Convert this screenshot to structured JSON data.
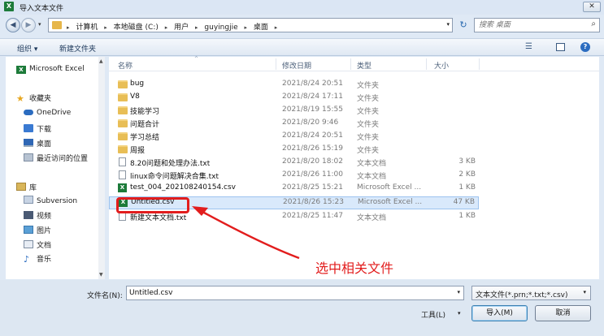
{
  "window": {
    "title": "导入文本文件",
    "app_icon_text": "X",
    "close_label": "✕"
  },
  "nav": {
    "back": "◀",
    "forward": "▶",
    "dropdown": "▾",
    "refresh": "↻"
  },
  "address": {
    "crumbs": [
      "计算机",
      "本地磁盘 (C:)",
      "用户",
      "guyingjie",
      "桌面"
    ],
    "separator": "▸",
    "dropdown": "▾"
  },
  "search": {
    "placeholder": "搜索 桌面",
    "icon": "search-icon"
  },
  "toolbar": {
    "organize": "组织 ▾",
    "new_folder": "新建文件夹",
    "view_icon": "☰",
    "help": "?"
  },
  "sidebar": {
    "items": [
      {
        "label": "Microsoft Excel",
        "icon": "X"
      },
      {
        "label": "收藏夹",
        "icon": "★"
      },
      {
        "label": "OneDrive",
        "icon": ""
      },
      {
        "label": "下载",
        "icon": ""
      },
      {
        "label": "桌面",
        "icon": ""
      },
      {
        "label": "最近访问的位置",
        "icon": ""
      },
      {
        "label": "库",
        "icon": ""
      },
      {
        "label": "Subversion",
        "icon": ""
      },
      {
        "label": "视频",
        "icon": ""
      },
      {
        "label": "图片",
        "icon": ""
      },
      {
        "label": "文档",
        "icon": ""
      },
      {
        "label": "音乐",
        "icon": "♪"
      }
    ],
    "scroll_up": "▲",
    "scroll_down": "▼"
  },
  "columns": {
    "name": "名称",
    "date": "修改日期",
    "type": "类型",
    "size": "大小",
    "sort_arrow": "^"
  },
  "files": [
    {
      "name": "bug",
      "date": "2021/8/24 20:51",
      "type": "文件夹",
      "size": "",
      "kind": "folder"
    },
    {
      "name": "V8",
      "date": "2021/8/24 17:11",
      "type": "文件夹",
      "size": "",
      "kind": "folder"
    },
    {
      "name": "技能学习",
      "date": "2021/8/19 15:55",
      "type": "文件夹",
      "size": "",
      "kind": "folder"
    },
    {
      "name": "问题合计",
      "date": "2021/8/20 9:46",
      "type": "文件夹",
      "size": "",
      "kind": "folder"
    },
    {
      "name": "学习总结",
      "date": "2021/8/24 20:51",
      "type": "文件夹",
      "size": "",
      "kind": "folder"
    },
    {
      "name": "周报",
      "date": "2021/8/26 15:19",
      "type": "文件夹",
      "size": "",
      "kind": "folder"
    },
    {
      "name": "8.20问题和处理办法.txt",
      "date": "2021/8/20 18:02",
      "type": "文本文档",
      "size": "3 KB",
      "kind": "txt"
    },
    {
      "name": "linux命令问题解决合集.txt",
      "date": "2021/8/26 11:00",
      "type": "文本文档",
      "size": "2 KB",
      "kind": "txt"
    },
    {
      "name": "test_004_202108240154.csv",
      "date": "2021/8/25 15:21",
      "type": "Microsoft Excel ...",
      "size": "1 KB",
      "kind": "xls"
    },
    {
      "name": "Untitled.csv",
      "date": "2021/8/26 15:23",
      "type": "Microsoft Excel ...",
      "size": "47 KB",
      "kind": "xls",
      "selected": true
    },
    {
      "name": "新建文本文档.txt",
      "date": "2021/8/25 11:47",
      "type": "文本文档",
      "size": "1 KB",
      "kind": "txt"
    }
  ],
  "annotation": {
    "text": "选中相关文件",
    "color": "#e21d1d"
  },
  "footer": {
    "filename_label": "文件名(N):",
    "filename_value": "Untitled.csv",
    "filetype_value": "文本文件(*.prn;*.txt;*.csv)",
    "tools_label": "工具(L)",
    "import_label": "导入(M)",
    "cancel_label": "取消",
    "dropdown": "▾"
  }
}
